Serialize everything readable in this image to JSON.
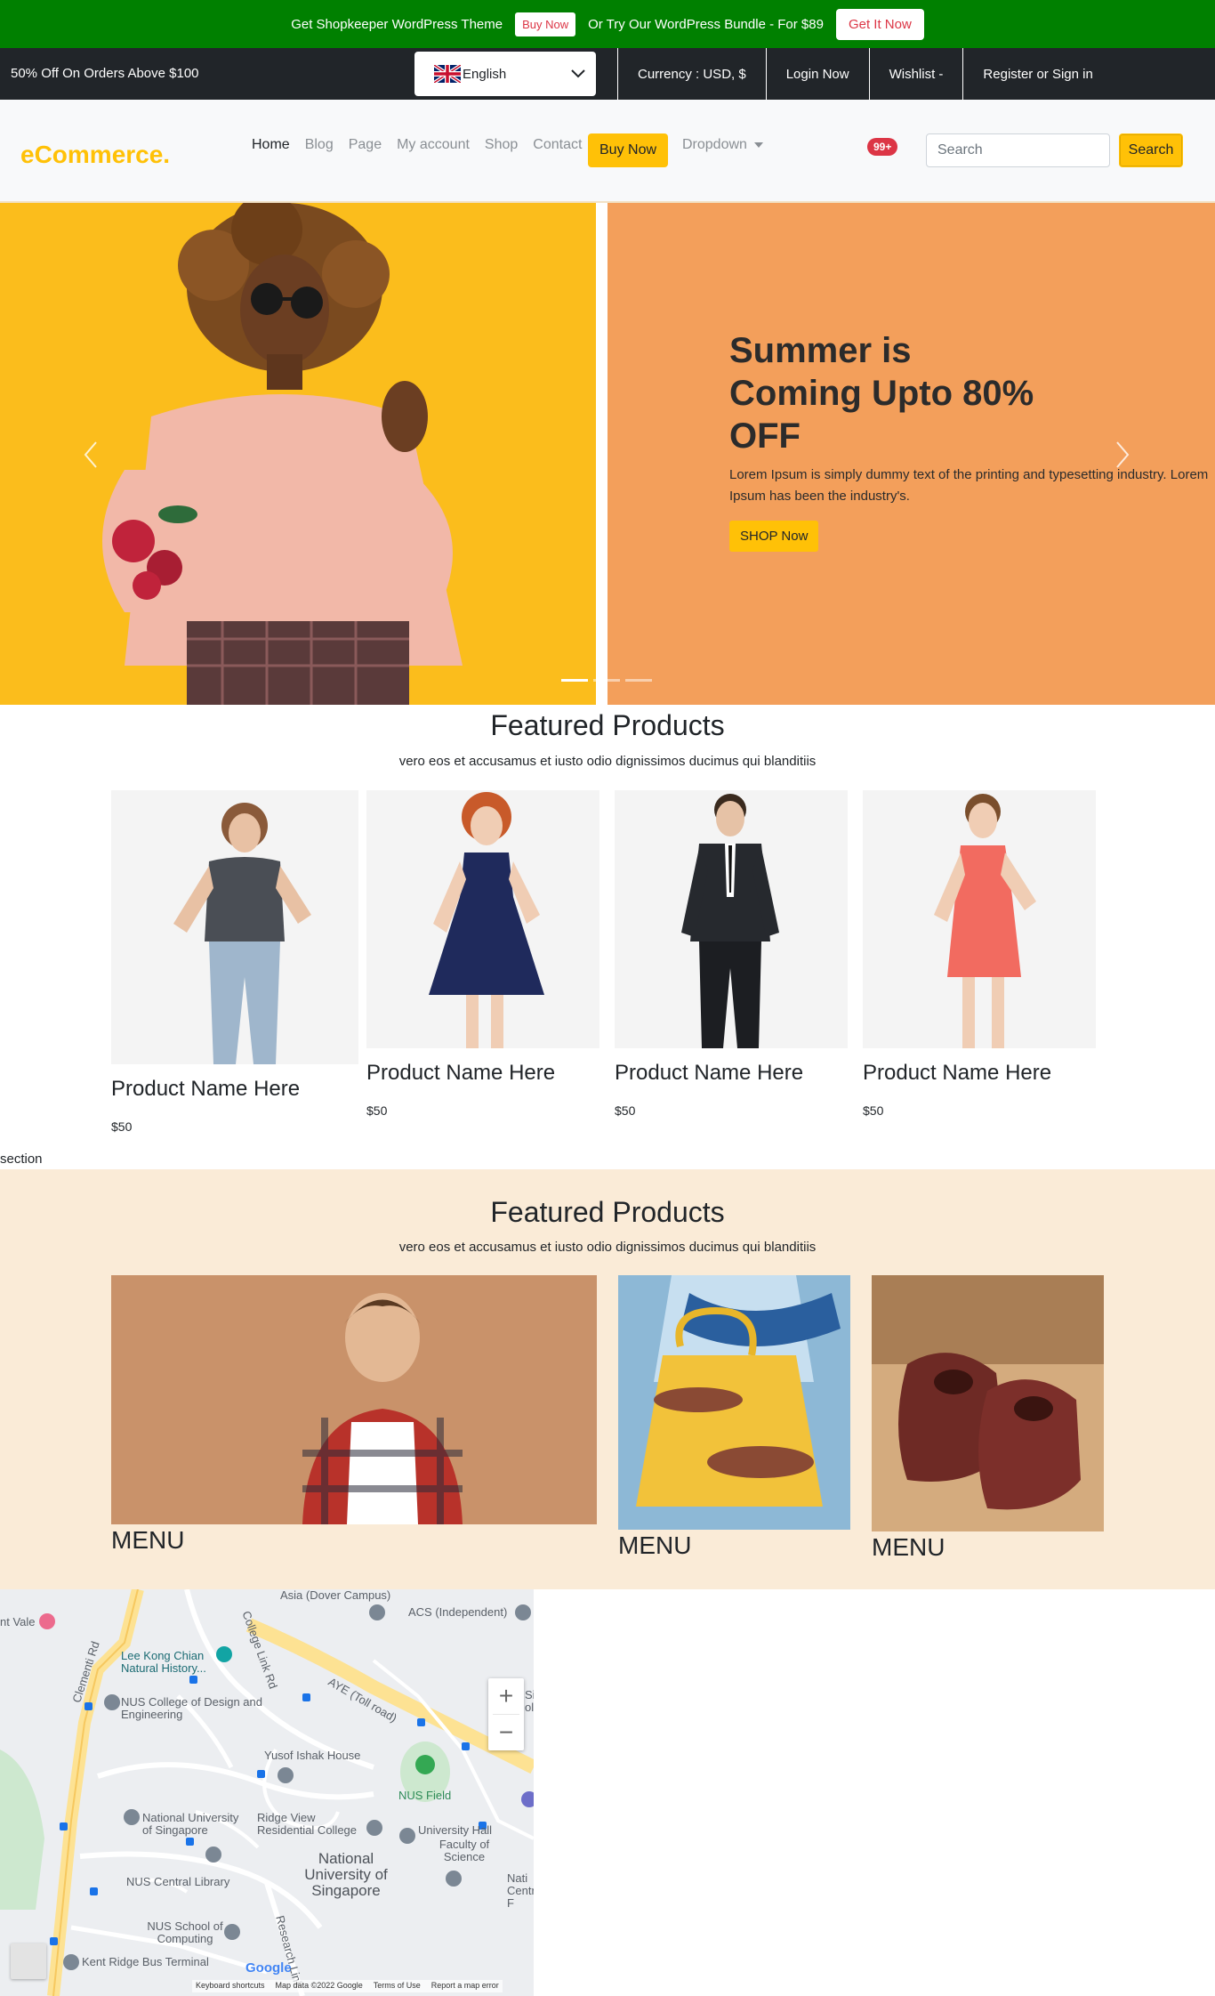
{
  "promo": {
    "text1": "Get Shopkeeper WordPress Theme",
    "btn1": "Buy Now",
    "text2": "Or Try Our WordPress Bundle - For $89",
    "btn2": "Get It Now"
  },
  "topbar": {
    "offer": "50% Off On Orders Above $100",
    "language": "English",
    "links": [
      "Currency : USD, $",
      "Login Now",
      "Wishlist -",
      "Register or Sign in"
    ]
  },
  "navbar": {
    "brand": "eCommerce.",
    "links": [
      "Home",
      "Blog",
      "Page",
      "My account",
      "Shop",
      "Contact"
    ],
    "buy_now": "Buy Now",
    "dropdown": "Dropdown",
    "badge": "99+",
    "search_placeholder": "Search",
    "search_button": "Search"
  },
  "hero": {
    "title": "Summer is Coming Upto 80% OFF",
    "text": "Lorem Ipsum is simply dummy text of the printing and typesetting industry. Lorem Ipsum has been the industry's.",
    "button": "SHOP Now",
    "slide_count": 3,
    "active_slide": 1
  },
  "featured1": {
    "title": "Featured Products",
    "subtitle": "vero eos et accusamus et iusto odio dignissimos ducimus qui blanditiis",
    "products": [
      {
        "name": "Product Name Here",
        "price": "$50"
      },
      {
        "name": "Product Name Here",
        "price": "$50"
      },
      {
        "name": "Product Name Here",
        "price": "$50"
      },
      {
        "name": "Product Name Here",
        "price": "$50"
      }
    ]
  },
  "section_label": "section",
  "featured2": {
    "title": "Featured Products",
    "subtitle": "vero eos et accusamus et iusto odio dignissimos ducimus qui blanditiis",
    "cards": [
      {
        "label": "MENU"
      },
      {
        "label": "MENU"
      },
      {
        "label": "MENU"
      }
    ]
  },
  "map": {
    "labels": {
      "vale": "nt Vale",
      "asia": "Asia (Dover Campus)",
      "acs": "ACS (Independent)",
      "leekong": "Lee Kong Chian Natural History...",
      "nuscde": "NUS College of Design and Engineering",
      "aye": "AYE (Toll road)",
      "clementi": "Clementi Rd",
      "college_link": "College Link Rd",
      "yusof": "Yusof Ishak House",
      "nusfield": "NUS Field",
      "nus_sg": "National University of Singapore",
      "ridgeview": "Ridge View Residential College",
      "uhall": "University Hall",
      "science": "Faculty of Science",
      "nus_big": "National University of Singapore",
      "library": "NUS Central Library",
      "computing": "NUS School of Computing",
      "kentridge": "Kent Ridge Bus Terminal",
      "research": "Research Link",
      "centre": "Nati Centre F",
      "si": "Si ol"
    },
    "footer": [
      "Keyboard shortcuts",
      "Map data ©2022 Google",
      "Terms of Use",
      "Report a map error"
    ],
    "google": "Google"
  },
  "colors": {
    "promo_green": "#008000",
    "dark": "#212529",
    "accent_yellow": "#ffc107",
    "hero_orange": "#f39f5b",
    "hero_yellow": "#fbbd1c",
    "section_bg": "#faebd7",
    "badge_red": "#dc3545"
  }
}
